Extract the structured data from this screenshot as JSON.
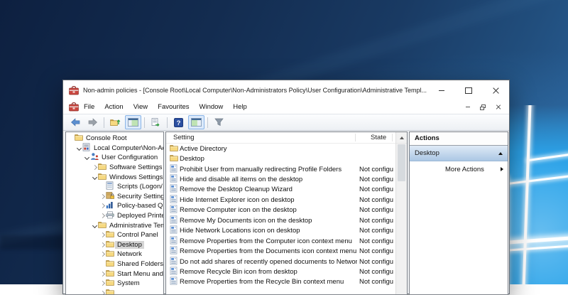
{
  "window": {
    "title": "Non-admin policies - [Console Root\\Local Computer\\Non-Administrators Policy\\User Configuration\\Administrative Templ..."
  },
  "menu": {
    "items": [
      "File",
      "Action",
      "View",
      "Favourites",
      "Window",
      "Help"
    ]
  },
  "toolbar": {
    "groups": [
      [
        "back",
        "forward"
      ],
      [
        "up-one-level",
        "show-console-tree"
      ],
      [
        "export-list"
      ],
      [
        "help",
        "show-action-pane"
      ],
      [
        "filter"
      ]
    ],
    "highlighted": [
      "show-console-tree",
      "show-action-pane"
    ],
    "help_glyph": "?"
  },
  "tree": {
    "items": [
      {
        "label": "Console Root",
        "level": 0,
        "expander": "none",
        "icon": "folder",
        "selected": false
      },
      {
        "label": "Local Computer\\Non-Adm",
        "level": 1,
        "expander": "expanded",
        "icon": "gpo",
        "selected": false
      },
      {
        "label": "User Configuration",
        "level": 2,
        "expander": "expanded",
        "icon": "user",
        "selected": false
      },
      {
        "label": "Software Settings",
        "level": 3,
        "expander": "collapsed",
        "icon": "folder",
        "selected": false
      },
      {
        "label": "Windows Settings",
        "level": 3,
        "expander": "expanded",
        "icon": "folder",
        "selected": false
      },
      {
        "label": "Scripts (Logon/",
        "level": 4,
        "expander": "none",
        "icon": "script",
        "selected": false
      },
      {
        "label": "Security Setting",
        "level": 4,
        "expander": "collapsed",
        "icon": "security",
        "selected": false
      },
      {
        "label": "Policy-based Q",
        "level": 4,
        "expander": "collapsed",
        "icon": "qos",
        "selected": false
      },
      {
        "label": "Deployed Printe",
        "level": 4,
        "expander": "collapsed",
        "icon": "printer",
        "selected": false
      },
      {
        "label": "Administrative Tem",
        "level": 3,
        "expander": "expanded",
        "icon": "folder",
        "selected": false
      },
      {
        "label": "Control Panel",
        "level": 4,
        "expander": "collapsed",
        "icon": "folder",
        "selected": false
      },
      {
        "label": "Desktop",
        "level": 4,
        "expander": "collapsed",
        "icon": "folder",
        "selected": true
      },
      {
        "label": "Network",
        "level": 4,
        "expander": "collapsed",
        "icon": "folder",
        "selected": false
      },
      {
        "label": "Shared Folders",
        "level": 4,
        "expander": "none",
        "icon": "folder",
        "selected": false
      },
      {
        "label": "Start Menu and",
        "level": 4,
        "expander": "collapsed",
        "icon": "folder",
        "selected": false
      },
      {
        "label": "System",
        "level": 4,
        "expander": "collapsed",
        "icon": "folder",
        "selected": false
      },
      {
        "label": "",
        "level": 4,
        "expander": "collapsed",
        "icon": "folder",
        "selected": false
      }
    ]
  },
  "list": {
    "columns": [
      "Setting",
      "State"
    ],
    "rows": [
      {
        "icon": "folder",
        "setting": "Active Directory",
        "state": ""
      },
      {
        "icon": "folder",
        "setting": "Desktop",
        "state": ""
      },
      {
        "icon": "policy",
        "setting": "Prohibit User from manually redirecting Profile Folders",
        "state": "Not configu"
      },
      {
        "icon": "policy",
        "setting": "Hide and disable all items on the desktop",
        "state": "Not configu"
      },
      {
        "icon": "policy",
        "setting": "Remove the Desktop Cleanup Wizard",
        "state": "Not configu"
      },
      {
        "icon": "policy",
        "setting": "Hide Internet Explorer icon on desktop",
        "state": "Not configu"
      },
      {
        "icon": "policy",
        "setting": "Remove Computer icon on the desktop",
        "state": "Not configu"
      },
      {
        "icon": "policy",
        "setting": "Remove My Documents icon on the desktop",
        "state": "Not configu"
      },
      {
        "icon": "policy",
        "setting": "Hide Network Locations icon on desktop",
        "state": "Not configu"
      },
      {
        "icon": "policy",
        "setting": "Remove Properties from the Computer icon context menu",
        "state": "Not configu"
      },
      {
        "icon": "policy",
        "setting": "Remove Properties from the Documents icon context menu",
        "state": "Not configu"
      },
      {
        "icon": "policy",
        "setting": "Do not add shares of recently opened documents to Networ...",
        "state": "Not configu"
      },
      {
        "icon": "policy",
        "setting": "Remove Recycle Bin icon from desktop",
        "state": "Not configu"
      },
      {
        "icon": "policy",
        "setting": "Remove Properties from the Recycle Bin context menu",
        "state": "Not configu"
      }
    ]
  },
  "actions": {
    "title": "Actions",
    "section_title": "Desktop",
    "items": [
      "More Actions"
    ]
  },
  "colors": {
    "desktop_navy": "#12294b",
    "logo_blue": "#2ba4ea",
    "selection_gray": "#d5d5d5",
    "actions_section_blue": "#bcd4ec",
    "help_button_blue": "#2b4fa0"
  }
}
